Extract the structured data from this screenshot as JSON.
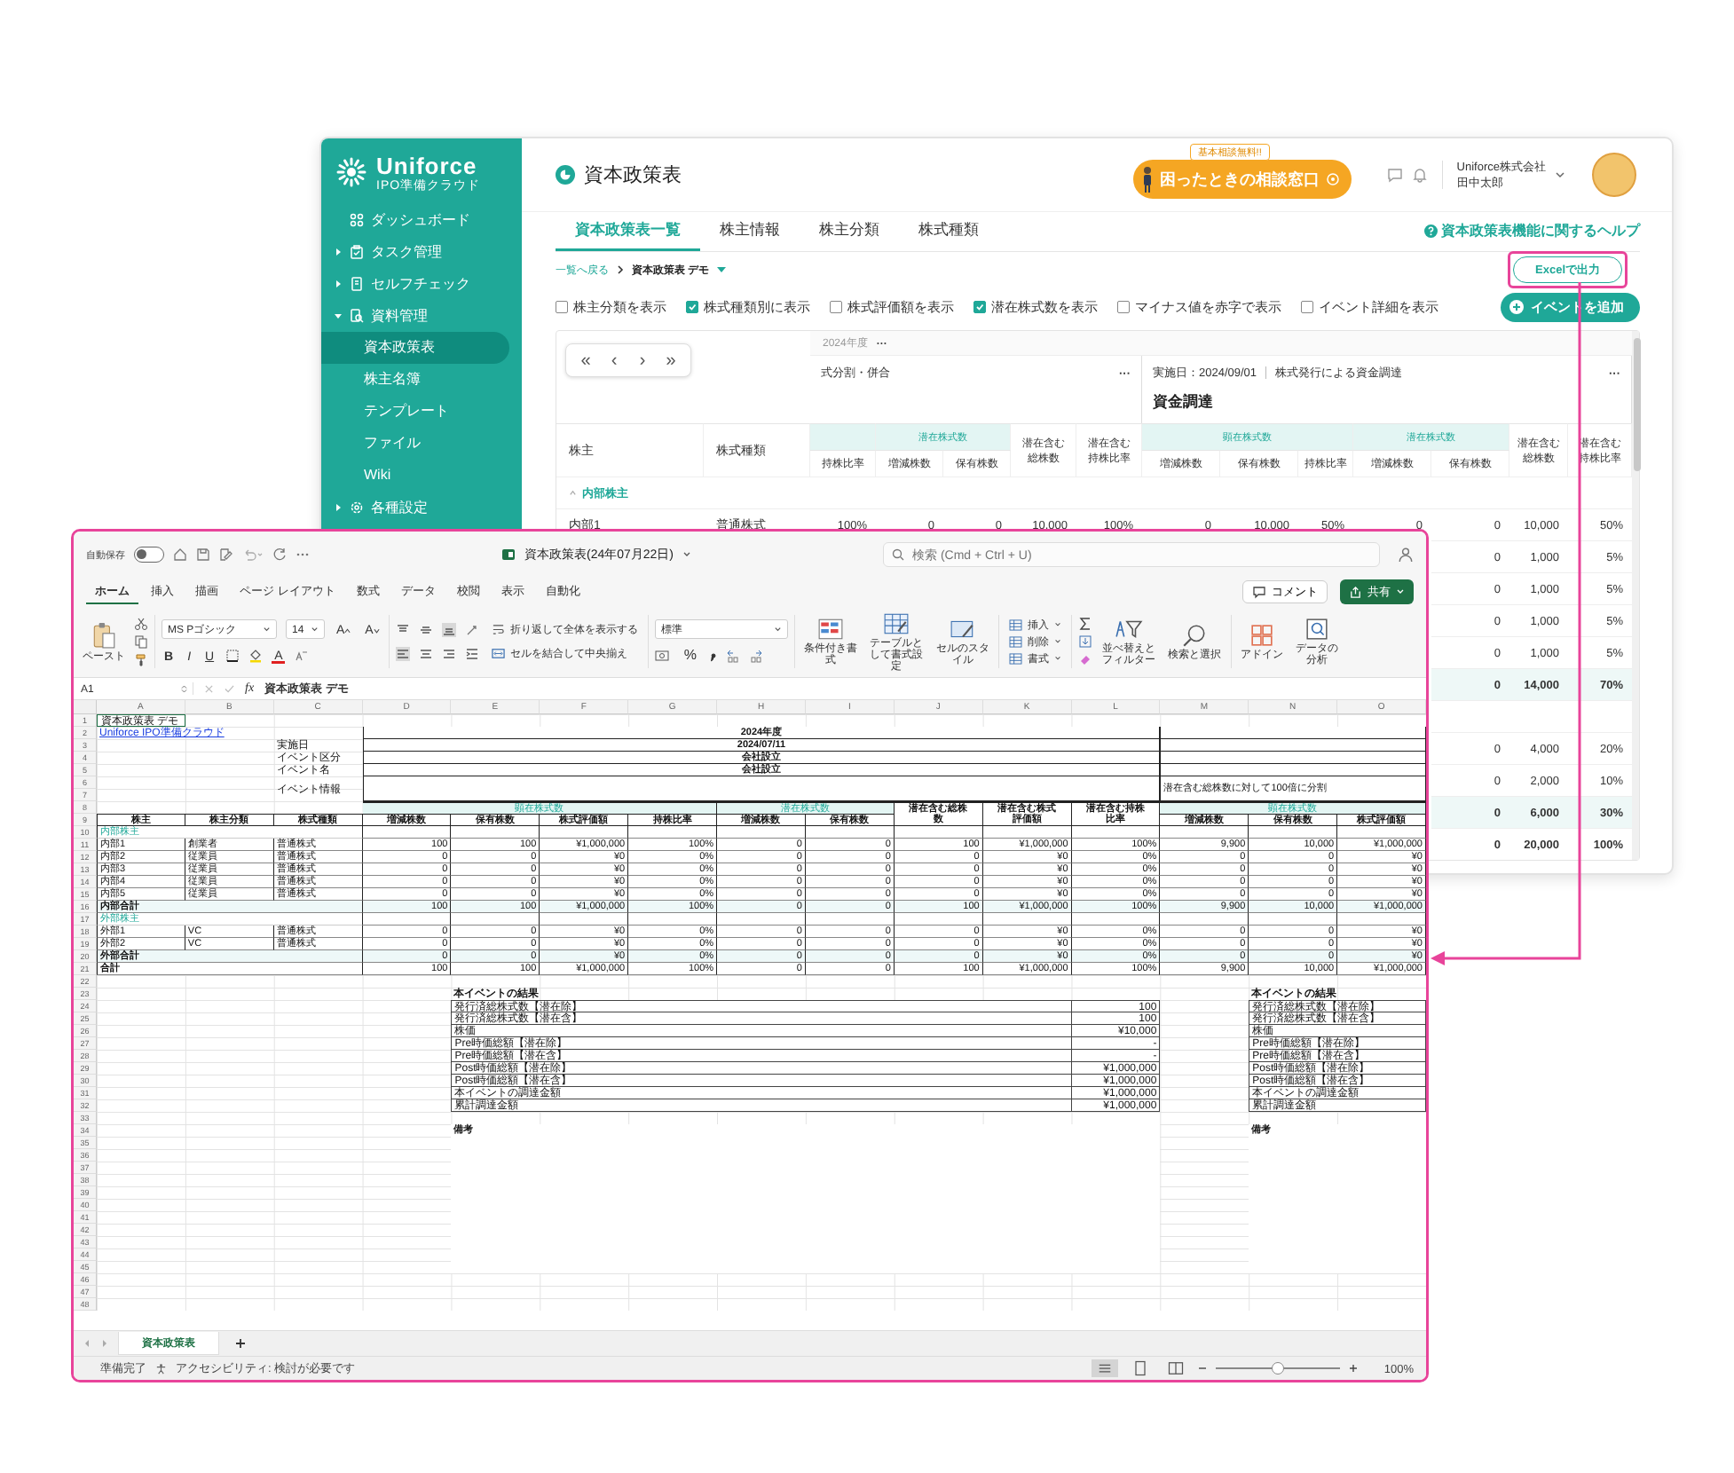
{
  "app": {
    "logo": {
      "name": "Uniforce",
      "tagline": "IPO準備クラウド"
    },
    "sidebar": [
      {
        "kind": "link",
        "label": "ダッシュボード"
      },
      {
        "kind": "folder",
        "label": "タスク管理",
        "expanded": false
      },
      {
        "kind": "folder",
        "label": "セルフチェック",
        "expanded": false
      },
      {
        "kind": "folder",
        "label": "資料管理",
        "expanded": true,
        "children": [
          {
            "label": "資本政策表",
            "selected": true
          },
          {
            "label": "株主名簿",
            "selected": false
          },
          {
            "label": "テンプレート",
            "selected": false
          },
          {
            "label": "ファイル",
            "selected": false
          },
          {
            "label": "Wiki",
            "selected": false
          }
        ]
      },
      {
        "kind": "folder",
        "label": "各種設定",
        "expanded": false
      }
    ],
    "header": {
      "title": "資本政策表",
      "consult_badge": "基本相談無料!!",
      "consult_label": "困ったときの相談窓口",
      "company": "Uniforce株式会社",
      "user": "田中太郎"
    },
    "tabs": [
      {
        "label": "資本政策表一覧",
        "selected": true
      },
      {
        "label": "株主情報",
        "selected": false
      },
      {
        "label": "株主分類",
        "selected": false
      },
      {
        "label": "株式種類",
        "selected": false
      }
    ],
    "help_link": "資本政策表機能に関するヘルプ",
    "breadcrumb": {
      "back": "一覧へ戻る",
      "current": "資本政策表 デモ"
    },
    "export_button": {
      "label": "Excelで出力",
      "highlighted": true
    },
    "options": [
      {
        "label": "株主分類を表示",
        "checked": false
      },
      {
        "label": "株式種類別に表示",
        "checked": true
      },
      {
        "label": "株式評価額を表示",
        "checked": false
      },
      {
        "label": "潜在株式数を表示",
        "checked": true
      },
      {
        "label": "マイナス値を赤字で表示",
        "checked": false
      },
      {
        "label": "イベント詳細を表示",
        "checked": false
      }
    ],
    "add_event_button": "イベントを追加",
    "table": {
      "pager": [
        "«",
        "‹",
        "›",
        "»"
      ],
      "year": "2024年度",
      "year_menu": "···",
      "events": [
        {
          "title": "式分割・併合",
          "menu": "···",
          "columns": [
            {
              "kind": "cut_group",
              "columns": [
                "持株比率"
              ]
            },
            {
              "kind": "group",
              "label": "潜在株式数",
              "columns": [
                "増減株数",
                "保有株数"
              ]
            },
            {
              "kind": "single",
              "label": "潜在含む総株数"
            },
            {
              "kind": "single",
              "label": "潜在含む持株比率"
            }
          ]
        },
        {
          "date": "実施日：2024/09/01",
          "title": "株式発行による資金調達",
          "category": "資金調達",
          "menu": "···",
          "columns": [
            {
              "kind": "group",
              "label": "顕在株式数",
              "columns": [
                "増減株数",
                "保有株数",
                "持株比率"
              ]
            },
            {
              "kind": "group",
              "label": "潜在株式数",
              "columns": [
                "増減株数",
                "保有株数"
              ]
            },
            {
              "kind": "single",
              "label": "潜在含む総株数"
            },
            {
              "kind": "single",
              "label": "潜在含む持株比率"
            }
          ]
        }
      ],
      "fixed_headers": [
        "株主",
        "株式種類"
      ],
      "group": {
        "label": "内部株主",
        "expanded": true
      },
      "row": {
        "name": "内部1",
        "type": "普通株式",
        "values": [
          "100%",
          "0",
          "0",
          "10,000",
          "100%",
          "0",
          "10,000",
          "50%",
          "0",
          "0",
          "10,000",
          "50%"
        ]
      },
      "covered_rows": [
        {
          "kind": "row",
          "values": [
            "0",
            "1,000",
            "5%"
          ]
        },
        {
          "kind": "row",
          "values": [
            "0",
            "1,000",
            "5%"
          ]
        },
        {
          "kind": "row",
          "values": [
            "0",
            "1,000",
            "5%"
          ]
        },
        {
          "kind": "row",
          "values": [
            "0",
            "1,000",
            "5%"
          ]
        },
        {
          "kind": "subtotal",
          "values": [
            "0",
            "14,000",
            "70%"
          ]
        },
        {
          "kind": "group"
        },
        {
          "kind": "row",
          "values": [
            "0",
            "4,000",
            "20%"
          ]
        },
        {
          "kind": "row",
          "values": [
            "0",
            "2,000",
            "10%"
          ]
        },
        {
          "kind": "subtotal",
          "values": [
            "0",
            "6,000",
            "30%"
          ]
        },
        {
          "kind": "total",
          "values": [
            "0",
            "20,000",
            "100%"
          ]
        }
      ]
    }
  },
  "excel": {
    "autosave": {
      "label": "自動保存",
      "on": false
    },
    "title": "資本政策表(24年07月22日)",
    "search": {
      "placeholder": "検索 (Cmd + Ctrl + U)"
    },
    "menu": [
      {
        "label": "ホーム",
        "selected": true
      },
      {
        "label": "挿入",
        "selected": false
      },
      {
        "label": "描画",
        "selected": false
      },
      {
        "label": "ページ レイアウト",
        "selected": false
      },
      {
        "label": "数式",
        "selected": false
      },
      {
        "label": "データ",
        "selected": false
      },
      {
        "label": "校閲",
        "selected": false
      },
      {
        "label": "表示",
        "selected": false
      },
      {
        "label": "自動化",
        "selected": false
      }
    ],
    "comment_button": "コメント",
    "share_button": "共有",
    "ribbon": {
      "paste": "ペースト",
      "font": "MS Pゴシック",
      "size": "14",
      "grow": "A",
      "shrink": "A",
      "styles": [
        "B",
        "I",
        "U"
      ],
      "font_color": "A",
      "wrap": "折り返して全体を表示する",
      "merge": "セルを結合して中央揃え",
      "number_format": "標準",
      "percent": "%",
      "style_tools": [
        "条件付き書式",
        "テーブルとして書式設定",
        "セルのスタイル"
      ],
      "cell_tools": [
        "挿入",
        "削除",
        "書式"
      ],
      "edit_tools": [
        "並べ替えとフィルター",
        "検索と選択"
      ],
      "extra_tools": [
        "アドイン",
        "データの分析"
      ]
    },
    "name_box": "A1",
    "fx": "fx",
    "formula": "資本政策表 デモ",
    "sheet": {
      "columns": [
        "A",
        "B",
        "C",
        "D",
        "E",
        "F",
        "G",
        "H",
        "I",
        "J",
        "K",
        "L",
        "M",
        "N",
        "O"
      ],
      "row_numbers": [
        "1",
        "2",
        "3",
        "4",
        "5",
        "6",
        "7",
        "8",
        "9",
        "10",
        "11",
        "12",
        "13",
        "14",
        "15",
        "16",
        "17",
        "18",
        "19",
        "20",
        "21",
        "22",
        "23",
        "24",
        "25",
        "26",
        "27",
        "28",
        "29",
        "30",
        "31",
        "32",
        "33",
        "34",
        "35",
        "36",
        "37",
        "38",
        "39",
        "40",
        "41",
        "42",
        "43",
        "44",
        "45",
        "46",
        "47",
        "48"
      ],
      "title": "資本政策表 デモ",
      "link": "Uniforce IPO準備クラウド",
      "event_rows": [
        {
          "value": "2024年度"
        },
        {
          "label": "実施日",
          "value": "2024/07/11"
        },
        {
          "label": "イベント区分",
          "value": "会社設立"
        },
        {
          "label": "イベント名",
          "value": "会社設立"
        }
      ],
      "event_info": {
        "label": "イベント情報",
        "note": "潜在含む総株数に対して100倍に分割"
      },
      "group_headers": [
        "顕在株式数",
        "潜在株式数",
        "顕在株式数"
      ],
      "headers": [
        "株主",
        "株主分類",
        "株式種類",
        "増減株数",
        "保有株数",
        "株式評価額",
        "持株比率",
        "増減株数",
        "保有株数",
        "潜在含む総株数",
        "潜在含む株式評価額",
        "潜在含む持株比率",
        "増減株数",
        "保有株数",
        "株式評価額"
      ],
      "body": [
        {
          "kind": "section",
          "label": "内部株主"
        },
        {
          "kind": "row",
          "cells": [
            "内部1",
            "創業者",
            "普通株式",
            "100",
            "100",
            "¥1,000,000",
            "100%",
            "0",
            "0",
            "100",
            "¥1,000,000",
            "100%",
            "9,900",
            "10,000",
            "¥1,000,000"
          ]
        },
        {
          "kind": "row",
          "cells": [
            "内部2",
            "従業員",
            "普通株式",
            "0",
            "0",
            "¥0",
            "0%",
            "0",
            "0",
            "0",
            "¥0",
            "0%",
            "0",
            "0",
            "¥0"
          ]
        },
        {
          "kind": "row",
          "cells": [
            "内部3",
            "従業員",
            "普通株式",
            "0",
            "0",
            "¥0",
            "0%",
            "0",
            "0",
            "0",
            "¥0",
            "0%",
            "0",
            "0",
            "¥0"
          ]
        },
        {
          "kind": "row",
          "cells": [
            "内部4",
            "従業員",
            "普通株式",
            "0",
            "0",
            "¥0",
            "0%",
            "0",
            "0",
            "0",
            "¥0",
            "0%",
            "0",
            "0",
            "¥0"
          ]
        },
        {
          "kind": "row",
          "cells": [
            "内部5",
            "従業員",
            "普通株式",
            "0",
            "0",
            "¥0",
            "0%",
            "0",
            "0",
            "0",
            "¥0",
            "0%",
            "0",
            "0",
            "¥0"
          ]
        },
        {
          "kind": "total",
          "label": "内部合計",
          "cells": [
            "100",
            "100",
            "¥1,000,000",
            "100%",
            "0",
            "0",
            "100",
            "¥1,000,000",
            "100%",
            "9,900",
            "10,000",
            "¥1,000,000"
          ]
        },
        {
          "kind": "section",
          "label": "外部株主"
        },
        {
          "kind": "row",
          "cells": [
            "外部1",
            "VC",
            "普通株式",
            "0",
            "0",
            "¥0",
            "0%",
            "0",
            "0",
            "0",
            "¥0",
            "0%",
            "0",
            "0",
            "¥0"
          ]
        },
        {
          "kind": "row",
          "cells": [
            "外部2",
            "VC",
            "普通株式",
            "0",
            "0",
            "¥0",
            "0%",
            "0",
            "0",
            "0",
            "¥0",
            "0%",
            "0",
            "0",
            "¥0"
          ]
        },
        {
          "kind": "total",
          "label": "外部合計",
          "cells": [
            "0",
            "0",
            "¥0",
            "0%",
            "0",
            "0",
            "0",
            "¥0",
            "0%",
            "0",
            "0",
            "¥0"
          ]
        },
        {
          "kind": "grand_total",
          "label": "合計",
          "cells": [
            "100",
            "100",
            "¥1,000,000",
            "100%",
            "0",
            "0",
            "100",
            "¥1,000,000",
            "100%",
            "9,900",
            "10,000",
            "¥1,000,000"
          ]
        }
      ],
      "results": [
        {
          "title": "本イベントの結果",
          "remarks": "備考",
          "items": [
            {
              "label": "発行済総株式数【潜在除】",
              "value": "100"
            },
            {
              "label": "発行済総株式数【潜在含】",
              "value": "100"
            },
            {
              "label": "株価",
              "value": "¥10,000"
            },
            {
              "label": "Pre時価総額【潜在除】",
              "value": "-"
            },
            {
              "label": "Pre時価総額【潜在含】",
              "value": "-"
            },
            {
              "label": "Post時価総額【潜在除】",
              "value": "¥1,000,000"
            },
            {
              "label": "Post時価総額【潜在含】",
              "value": "¥1,000,000"
            },
            {
              "label": "本イベントの調達金額",
              "value": "¥1,000,000"
            },
            {
              "label": "累計調達金額",
              "value": "¥1,000,000"
            }
          ]
        },
        {
          "title": "本イベントの結果",
          "remarks": "備考",
          "items": [
            {
              "label": "発行済総株式数【潜在除】"
            },
            {
              "label": "発行済総株式数【潜在含】"
            },
            {
              "label": "株価"
            },
            {
              "label": "Pre時価総額【潜在除】"
            },
            {
              "label": "Pre時価総額【潜在含】"
            },
            {
              "label": "Post時価総額【潜在除】"
            },
            {
              "label": "Post時価総額【潜在含】"
            },
            {
              "label": "本イベントの調達金額"
            },
            {
              "label": "累計調達金額"
            }
          ]
        }
      ]
    },
    "sheet_tab": {
      "label": "資本政策表",
      "selected": true
    },
    "status": "準備完了",
    "accessibility": "アクセシビリティ: 検討が必要です",
    "zoom": {
      "level": 0.5,
      "reading": "100%"
    }
  }
}
